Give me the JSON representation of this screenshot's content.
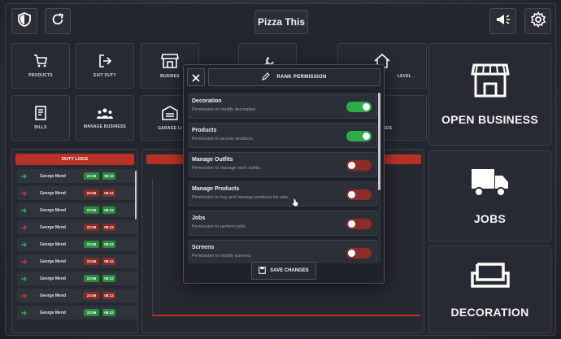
{
  "header": {
    "title": "Pizza This",
    "home_icon": "shield-icon",
    "refresh_icon": "refresh-icon",
    "announce_icon": "megaphone-icon",
    "settings_icon": "gear-icon"
  },
  "tiles": [
    {
      "label": "PRODUCTS",
      "icon": "cart-icon"
    },
    {
      "label": "EXIT DUTY",
      "icon": "exit-icon"
    },
    {
      "label": "BUSINES",
      "icon": "store-icon"
    },
    {
      "label": "",
      "icon": "wrench-icon"
    },
    {
      "label": "LEVEL",
      "icon": "home-icon"
    },
    {
      "label": "BILLS",
      "icon": "receipt-icon"
    },
    {
      "label": "MANAGE BUSINESS",
      "icon": "people-icon"
    },
    {
      "label": "GARAGE LI",
      "icon": "garage-icon"
    },
    {
      "label": "NDS",
      "icon": "cash-icon"
    }
  ],
  "big_tiles": [
    {
      "label": "OPEN BUSINESS",
      "icon": "store-icon"
    },
    {
      "label": "JOBS",
      "icon": "truck-icon"
    },
    {
      "label": "DECORATION",
      "icon": "sofa-icon"
    }
  ],
  "duty_logs": {
    "title": "DUTY LOGS",
    "rows": [
      {
        "name": "George Mend",
        "status": "on",
        "time": "23:56",
        "date": "08:12"
      },
      {
        "name": "George Mend",
        "status": "off",
        "time": "23:56",
        "date": "08:12"
      },
      {
        "name": "George Mend",
        "status": "on",
        "time": "23:56",
        "date": "08:12"
      },
      {
        "name": "George Mend",
        "status": "off",
        "time": "23:56",
        "date": "08:12"
      },
      {
        "name": "George Mend",
        "status": "on",
        "time": "23:56",
        "date": "08:12"
      },
      {
        "name": "George Mend",
        "status": "off",
        "time": "23:56",
        "date": "08:12"
      },
      {
        "name": "George Mend",
        "status": "on",
        "time": "23:56",
        "date": "08:12"
      },
      {
        "name": "George Mend",
        "status": "off",
        "time": "23:56",
        "date": "08:12"
      },
      {
        "name": "George Mend",
        "status": "on",
        "time": "23:56",
        "date": "08:12"
      }
    ]
  },
  "modal": {
    "title": "RANK PERMISSION",
    "save_label": "SAVE CHANGES",
    "permissions": [
      {
        "title": "Decoration",
        "desc": "Permission to modify decoration.",
        "enabled": true
      },
      {
        "title": "Products",
        "desc": "Permission to access products.",
        "enabled": true
      },
      {
        "title": "Manage Outfits",
        "desc": "Permission to manage work outfits.",
        "enabled": false
      },
      {
        "title": "Manage Products",
        "desc": "Permission to buy and manage products for sale.",
        "enabled": false
      },
      {
        "title": "Jobs",
        "desc": "Permission to perform jobs.",
        "enabled": false
      },
      {
        "title": "Screens",
        "desc": "Permission to modify screens.",
        "enabled": false
      }
    ]
  },
  "colors": {
    "accent_red": "#b83126",
    "toggle_on": "#2fab48",
    "toggle_off": "#8e2d27"
  }
}
